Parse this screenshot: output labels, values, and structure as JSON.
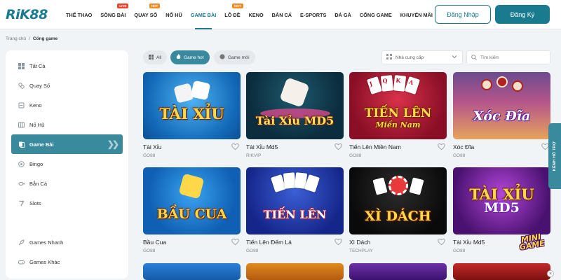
{
  "brand": {
    "logo": "RiK88",
    "accent": "#1a7b8f"
  },
  "header": {
    "nav": [
      {
        "label": "THỂ THAO",
        "badge": ""
      },
      {
        "label": "SÒNG BÀI",
        "badge": "LIVE"
      },
      {
        "label": "QUAY SỐ",
        "badge": "HOT"
      },
      {
        "label": "NỔ HŨ",
        "badge": ""
      },
      {
        "label": "GAME BÀI",
        "badge": ""
      },
      {
        "label": "LÔ ĐỀ",
        "badge": "HOT"
      },
      {
        "label": "KENO",
        "badge": ""
      },
      {
        "label": "BẮN CÁ",
        "badge": ""
      },
      {
        "label": "E-SPORTS",
        "badge": ""
      },
      {
        "label": "ĐÁ GÀ",
        "badge": ""
      },
      {
        "label": "CỔNG GAME",
        "badge": ""
      },
      {
        "label": "KHUYẾN MÃI",
        "badge": ""
      }
    ],
    "login_label": "Đăng Nhập",
    "register_label": "Đăng Ký"
  },
  "breadcrumb": {
    "home": "Trang chủ",
    "separator": "/",
    "current": "Cổng game"
  },
  "sidebar": {
    "items": [
      {
        "label": "Tất Cả",
        "icon": "grid-icon"
      },
      {
        "label": "Quay Số",
        "icon": "balls-icon"
      },
      {
        "label": "Keno",
        "icon": "ticket-icon"
      },
      {
        "label": "Nổ Hũ",
        "icon": "slot-icon"
      },
      {
        "label": "Game Bài",
        "icon": "cards-icon"
      },
      {
        "label": "Bingo",
        "icon": "bingo-icon"
      },
      {
        "label": "Bắn Cá",
        "icon": "fish-icon"
      },
      {
        "label": "Slots",
        "icon": "seven-icon"
      },
      {
        "label": "Games Nhanh",
        "icon": "rocket-icon"
      },
      {
        "label": "Games Khác",
        "icon": "controller-icon"
      }
    ]
  },
  "filters": {
    "tabs": [
      {
        "label": "All"
      },
      {
        "label": "Game hot"
      },
      {
        "label": "Game mới"
      }
    ],
    "provider_placeholder": "Nhà cung cấp",
    "search_placeholder": "Tìm kiếm"
  },
  "games": [
    {
      "name": "Tài Xỉu",
      "provider": "GO88",
      "art": "TÀI XỈU"
    },
    {
      "name": "Tài Xỉu Md5",
      "provider": "RIKVIP",
      "art": "Tài Xỉu MD5"
    },
    {
      "name": "Tiến Lên Miền Nam",
      "provider": "GO88",
      "art": "TIẾN LÊN",
      "art2": "Miền Nam"
    },
    {
      "name": "Xóc Đĩa",
      "provider": "GO88",
      "art": "Xóc Đĩa"
    },
    {
      "name": "Bầu Cua",
      "provider": "GO88",
      "art": "BẦU CUA"
    },
    {
      "name": "Tiến Lên Đếm Lá",
      "provider": "GO88",
      "art": "TIẾN LÊN"
    },
    {
      "name": "Xì Dách",
      "provider": "TECHPLAY",
      "art": "XÌ DÁCH"
    },
    {
      "name": "Tài Xỉu Md5",
      "provider": "GO88",
      "art": "TÀI XỈU",
      "art2": "MD5"
    }
  ],
  "support_tab": "KÊNH HỖ TRỢ",
  "mini_game": {
    "line1": "MINI",
    "line2": "GAME"
  },
  "card_letters": {
    "j": "J",
    "q": "Q",
    "k": "K",
    "a": "A"
  }
}
